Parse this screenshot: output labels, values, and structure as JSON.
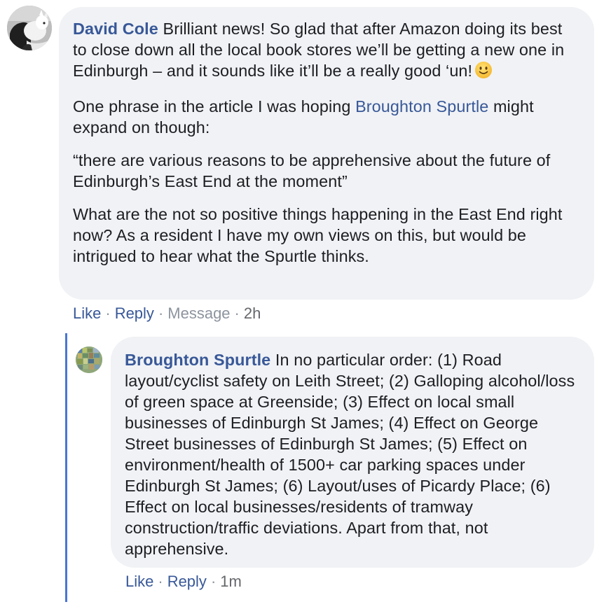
{
  "comment": {
    "author": "David Cole",
    "paragraphs": {
      "p1": "Brilliant news! So glad that after Amazon doing its best to close down all the local book stores we’ll be getting a new one in Edinburgh – and it sounds like it’ll be a really good ‘un!",
      "p2_before": "One phrase in the article I was hoping",
      "p2_mention": "Broughton Spurtle",
      "p2_after": "might expand on though:",
      "p3": "“there are various reasons to be apprehensive about the future of Edinburgh’s East End at the moment”",
      "p4": "What are the not so positive things happening in the East End right now? As a resident I have my own views on this, but would be intrigued to hear what the Spurtle thinks."
    },
    "emoji": "slightly-smiling-face-emoji",
    "actions": {
      "like": "Like",
      "reply": "Reply",
      "message": "Message",
      "time": "2h",
      "separator": "·"
    }
  },
  "reply": {
    "author": "Broughton Spurtle",
    "text": "In no particular order: (1) Road layout/cyclist safety on Leith Street; (2) Galloping alcohol/loss of green space at Greenside; (3) Effect on local small businesses of Edinburgh St James; (4) Effect on George Street businesses of Edinburgh St James; (5) Effect on environment/health of 1500+ car parking spaces under Edinburgh St James; (6) Layout/uses of Picardy Place; (6) Effect on local businesses/residents of tramway construction/traffic deviations. Apart from that, not apprehensive.",
    "actions": {
      "like": "Like",
      "reply": "Reply",
      "time": "1m",
      "separator": "·"
    }
  },
  "colors": {
    "link": "#385898",
    "bubble": "#f0f2f5",
    "thread_line": "#4a76d4",
    "muted": "#8d949e"
  }
}
